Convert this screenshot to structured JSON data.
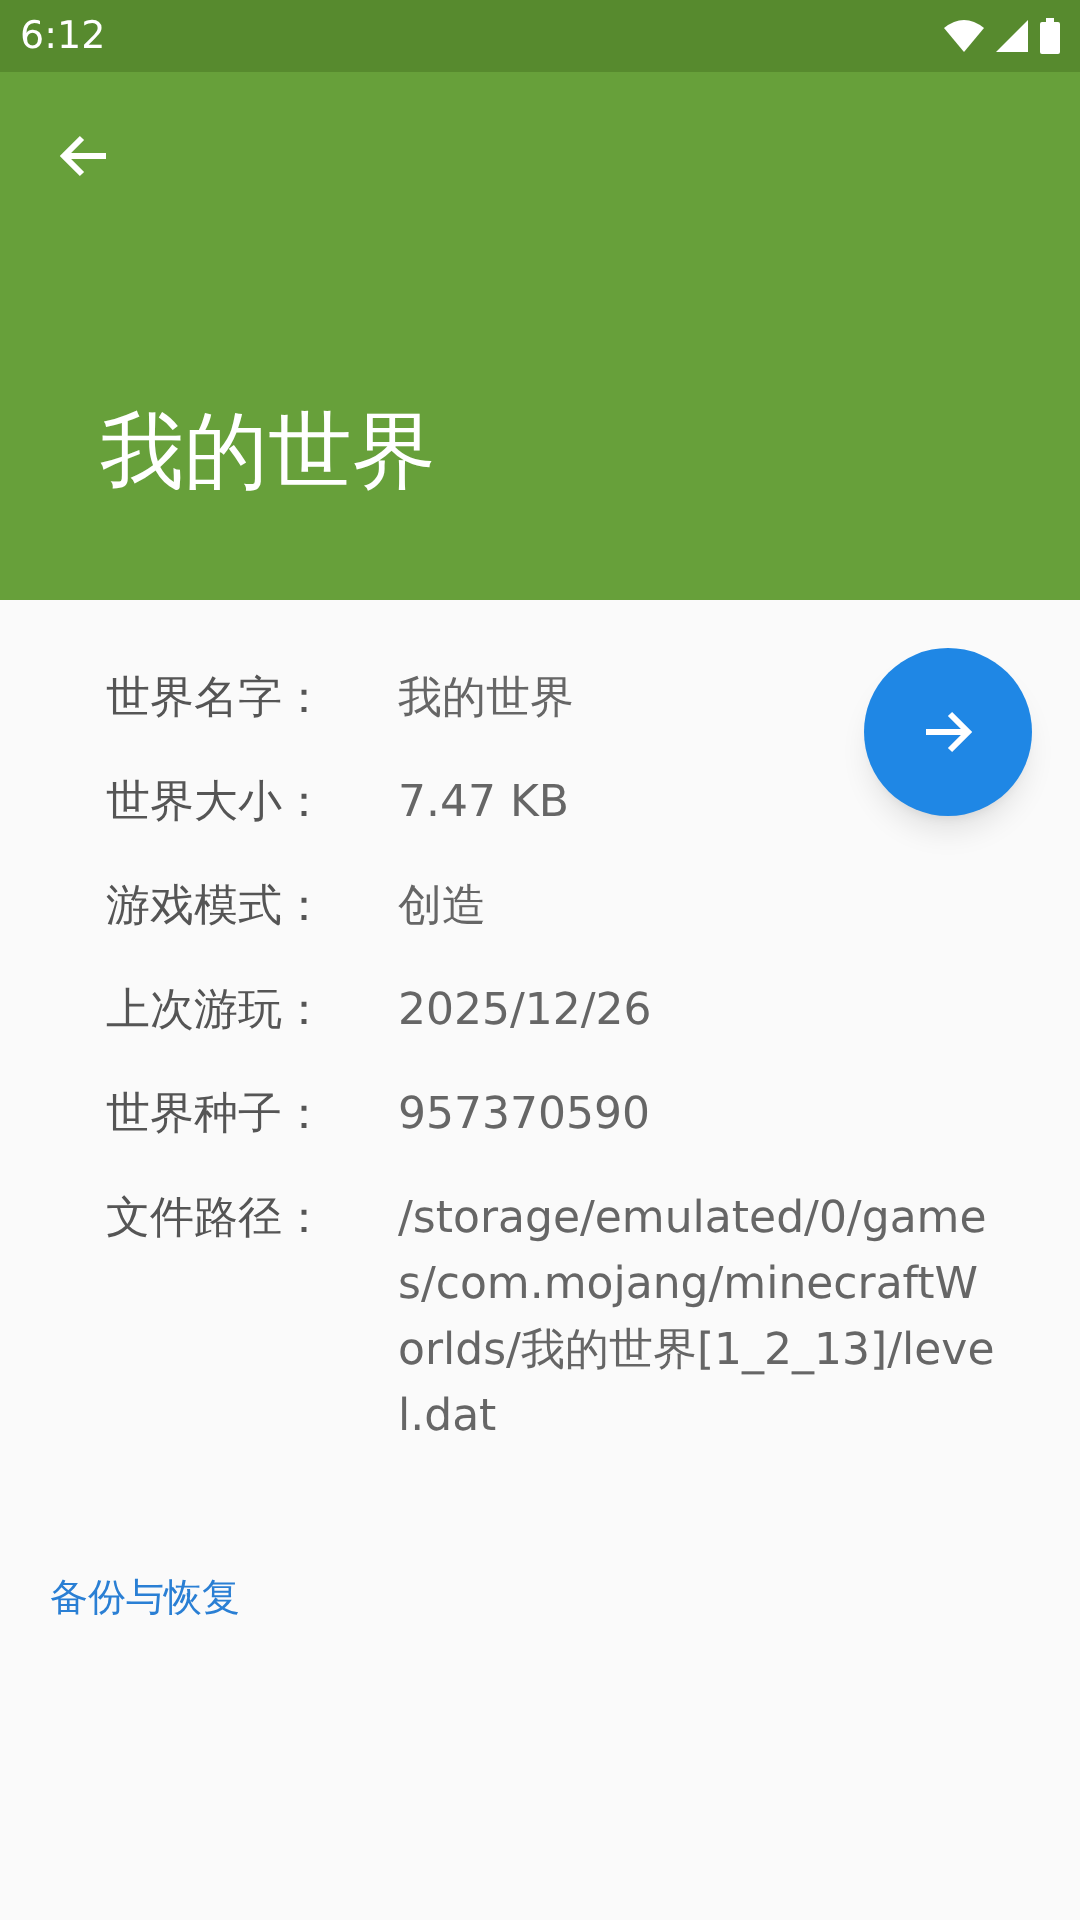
{
  "status_bar": {
    "time": "6:12"
  },
  "header": {
    "title": "我的世界"
  },
  "details": [
    {
      "label": "世界名字：",
      "value": "我的世界"
    },
    {
      "label": "世界大小：",
      "value": "7.47 KB"
    },
    {
      "label": "游戏模式：",
      "value": "创造"
    },
    {
      "label": "上次游玩：",
      "value": "2025/12/26"
    },
    {
      "label": "世界种子：",
      "value": "957370590"
    },
    {
      "label": "文件路径：",
      "value": "/storage/emulated/0/games/com.mojang/minecraftWorlds/我的世界[1_2_13]/level.dat"
    }
  ],
  "backup_link": "备份与恢复"
}
